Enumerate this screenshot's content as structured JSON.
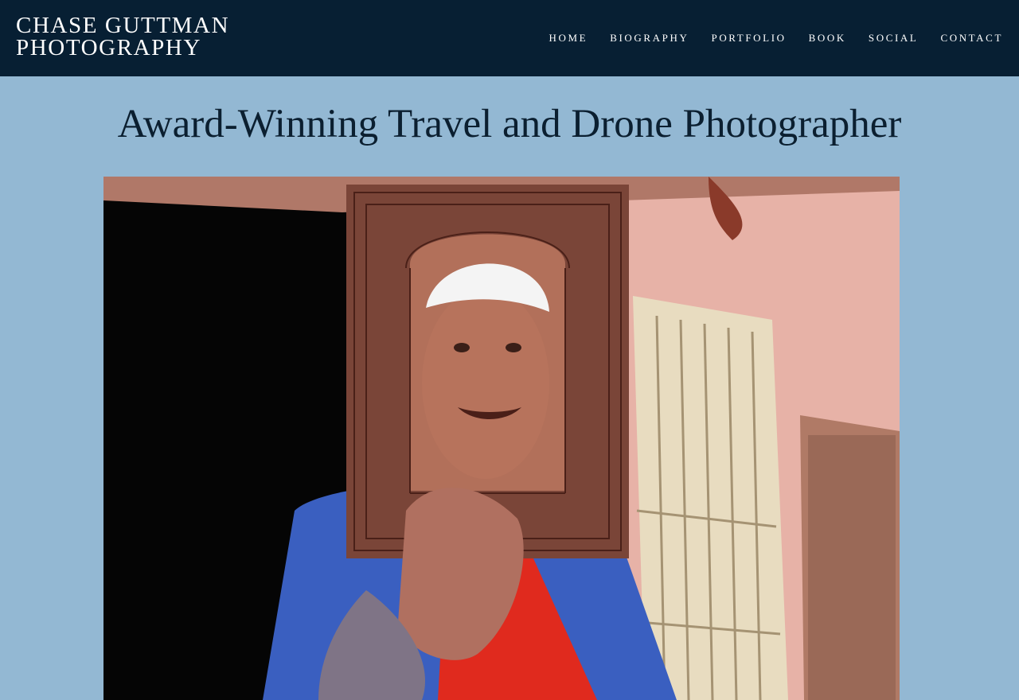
{
  "site": {
    "title_line1": "CHASE GUTTMAN",
    "title_line2": "PHOTOGRAPHY"
  },
  "nav": {
    "items": [
      {
        "label": "HOME"
      },
      {
        "label": "BIOGRAPHY"
      },
      {
        "label": "PORTFOLIO"
      },
      {
        "label": "BOOK"
      },
      {
        "label": "SOCIAL"
      },
      {
        "label": "CONTACT"
      }
    ]
  },
  "hero": {
    "headline": "Award-Winning Travel and Drone Photographer"
  },
  "colors": {
    "header_bg": "#071f33",
    "page_bg": "#93b8d3",
    "headline_text": "#0b1f30",
    "nav_text": "#ffffff"
  }
}
